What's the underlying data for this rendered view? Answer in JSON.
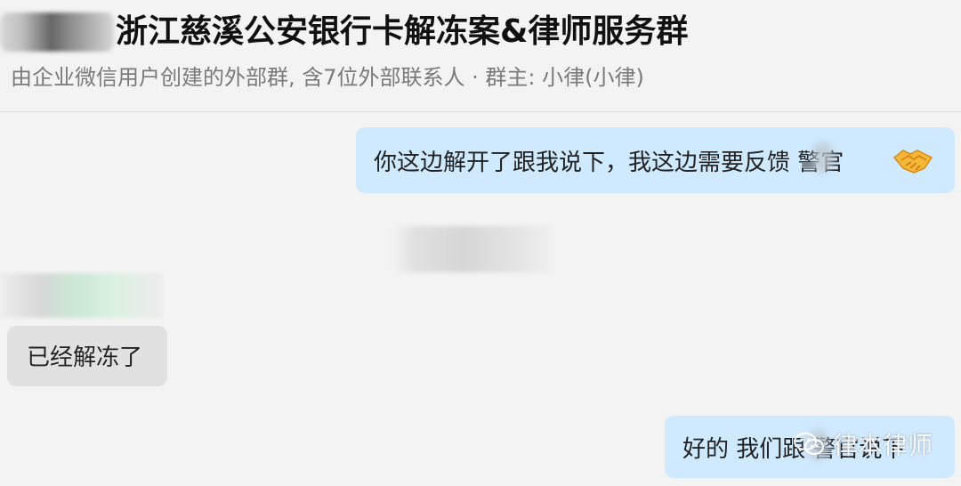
{
  "header": {
    "title": "浙江慈溪公安银行卡解冻案&律师服务群",
    "subtitle": "由企业微信用户创建的外部群, 含7位外部联系人 · 群主: 小律(小律)"
  },
  "messages": [
    {
      "direction": "outgoing",
      "text": "你这边解开了跟我说下，我这边需要反馈 警官",
      "emoji": "handshake-icon"
    },
    {
      "direction": "incoming",
      "text": "已经解冻了"
    },
    {
      "direction": "outgoing",
      "text": "好的 我们跟 警官说下"
    }
  ],
  "watermark": {
    "text": "律本律师",
    "icon": "wechat-icon"
  },
  "colors": {
    "background": "#f3f3f3",
    "outgoing_bubble": "#cfe9ff",
    "incoming_bubble": "#e1e1e1",
    "title_text": "#111111",
    "subtitle_text": "#7a7a7a"
  }
}
